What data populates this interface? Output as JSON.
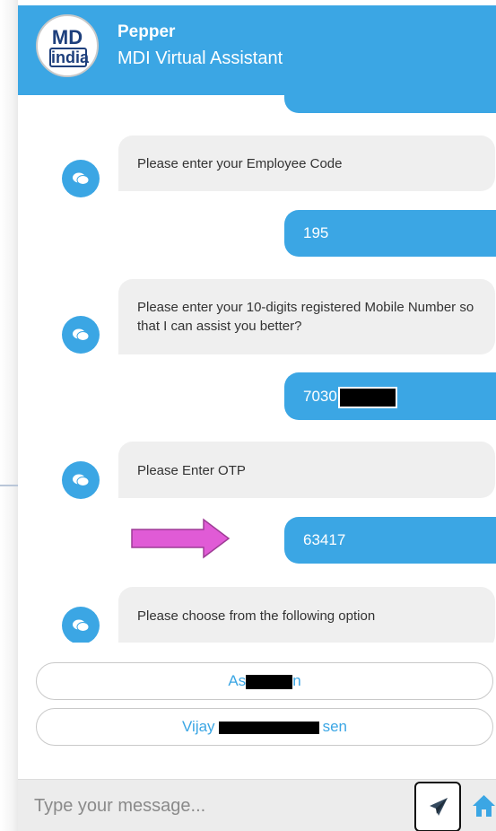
{
  "header": {
    "logo_top": "MD",
    "logo_bottom": "india",
    "title": "Pepper",
    "subtitle": "MDI Virtual Assistant"
  },
  "messages": [
    {
      "from": "user",
      "text": ""
    },
    {
      "from": "bot",
      "text": "Please enter your Employee Code"
    },
    {
      "from": "user",
      "text": "195"
    },
    {
      "from": "bot",
      "text": "Please enter your 10-digits registered Mobile Number so that I can assist you better?"
    },
    {
      "from": "user",
      "text": "7030",
      "redacted": true
    },
    {
      "from": "bot",
      "text": "Please Enter OTP"
    },
    {
      "from": "user",
      "text": "63417"
    },
    {
      "from": "bot",
      "text": "Please choose from the following option"
    }
  ],
  "options": [
    {
      "prefix": "As",
      "suffix": "n"
    },
    {
      "prefix": "Vijay",
      "suffix": "sen"
    }
  ],
  "input": {
    "placeholder": "Type your message..."
  },
  "icons": {
    "send": "send-icon",
    "home": "home-icon",
    "avatar": "chat-bubble-icon",
    "arrow": "arrow-right-icon"
  },
  "colors": {
    "accent": "#3ba6e4",
    "bot_bubble": "#efefef",
    "annotation_arrow": "#e05bd6"
  }
}
